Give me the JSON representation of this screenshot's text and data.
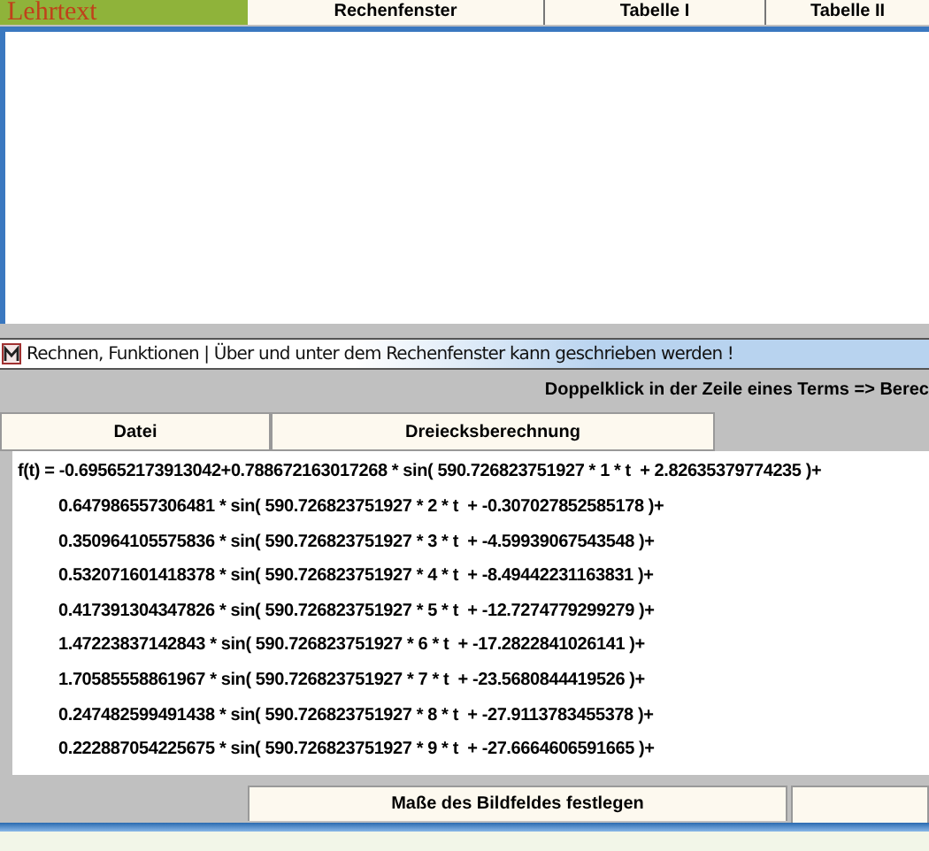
{
  "header_label": "Lehrtext",
  "tabs": [
    "Rechenfenster",
    "Tabelle I",
    "Tabelle II"
  ],
  "window": {
    "title": "Rechnen, Funktionen | Über und unter dem Rechenfenster kann geschrieben werden !"
  },
  "hint": "Doppelklick in der Zeile eines Terms => Berec",
  "toolbar": [
    "Datei",
    "Dreiecksberechnung"
  ],
  "formula_lines": [
    "f(t) = -0.695652173913042+0.788672163017268 * sin( 590.726823751927 * 1 * t  + 2.82635379774235 )+",
    "0.647986557306481 * sin( 590.726823751927 * 2 * t  + -0.307027852585178 )+",
    "0.350964105575836 * sin( 590.726823751927 * 3 * t  + -4.59939067543548 )+",
    "0.532071601418378 * sin( 590.726823751927 * 4 * t  + -8.49442231163831 )+",
    "0.417391304347826 * sin( 590.726823751927 * 5 * t  + -12.7274779299279 )+",
    "1.47223837142843 * sin( 590.726823751927 * 6 * t  + -17.2822841026141 )+",
    "1.70585558861967 * sin( 590.726823751927 * 7 * t  + -23.5680844419526 )+",
    "0.247482599491438 * sin( 590.726823751927 * 8 * t  + -27.9113783455378 )+",
    "0.222887054225675 * sin( 590.726823751927 * 9 * t  + -27.6664606591665 )+"
  ],
  "bottom_button": "Maße des Bildfeldes festlegen"
}
